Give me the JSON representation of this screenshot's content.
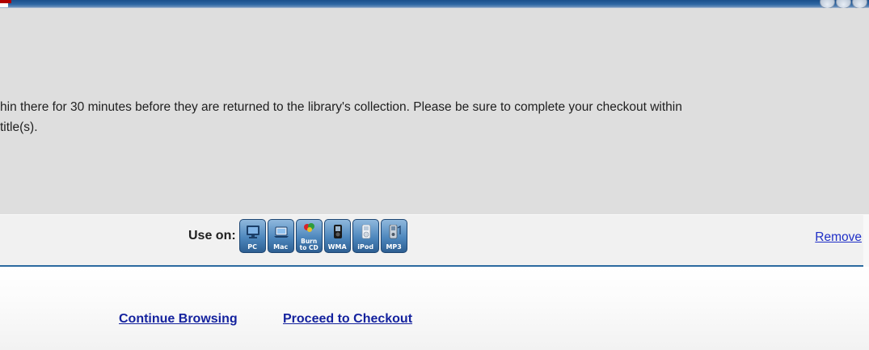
{
  "notice": {
    "line1": "hin there for 30 minutes before they are returned to the library's collection. Please be sure to complete your checkout within",
    "line2": "title(s)."
  },
  "title_row": {
    "use_on_label": "Use on:",
    "formats": [
      {
        "caption": "PC",
        "icon": "pc-monitor-icon"
      },
      {
        "caption": "Mac",
        "icon": "mac-laptop-icon"
      },
      {
        "caption": "Burn to CD",
        "icon": "burn-to-cd-icon"
      },
      {
        "caption": "WMA",
        "icon": "wma-player-icon"
      },
      {
        "caption": "iPod",
        "icon": "ipod-icon"
      },
      {
        "caption": "MP3",
        "icon": "mp3-player-icon"
      }
    ],
    "remove_label": "Remove"
  },
  "footer": {
    "continue_label": "Continue Browsing",
    "checkout_label": "Proceed to Checkout"
  },
  "colors": {
    "header": "#2f67a3",
    "panel": "#dedede",
    "link": "#14229e",
    "divider": "#2c6aa0"
  }
}
